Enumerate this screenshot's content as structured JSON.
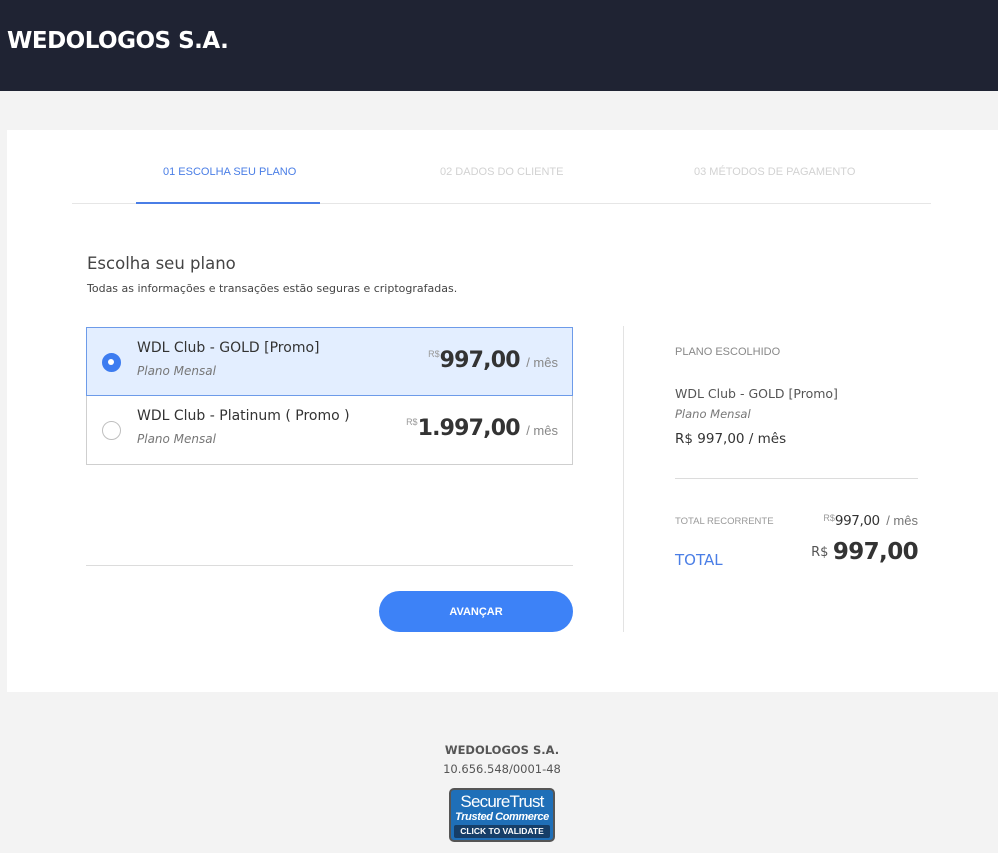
{
  "header": {
    "brand": "WEDOLOGOS S.A."
  },
  "steps": [
    {
      "label": "01 ESCOLHA SEU PLANO",
      "active": true
    },
    {
      "label": "02 DADOS DO CLIENTE",
      "active": false
    },
    {
      "label": "03 MÉTODOS DE PAGAMENTO",
      "active": false
    }
  ],
  "section": {
    "title": "Escolha seu plano",
    "subtitle": "Todas as informações e transações estão seguras e criptografadas."
  },
  "plans": [
    {
      "name": "WDL Club - GOLD [Promo]",
      "period": "Plano Mensal",
      "currency": "R$",
      "amount": "997,00",
      "per": "/ mês",
      "selected": true
    },
    {
      "name": "WDL Club - Platinum ( Promo )",
      "period": "Plano Mensal",
      "currency": "R$",
      "amount": "1.997,00",
      "per": "/ mês",
      "selected": false
    }
  ],
  "actions": {
    "next_label": "AVANÇAR"
  },
  "summary": {
    "heading": "PLANO ESCOLHIDO",
    "plan_name": "WDL Club - GOLD [Promo]",
    "plan_period": "Plano Mensal",
    "plan_price": "R$ 997,00 / mês",
    "recurring_label": "TOTAL RECORRENTE",
    "recurring_currency": "R$",
    "recurring_amount": "997,00",
    "recurring_per": "/ mês",
    "total_label": "TOTAL",
    "total_currency": "R$",
    "total_amount": "997,00"
  },
  "footer": {
    "company": "WEDOLOGOS S.A.",
    "cnpj": "10.656.548/0001-48",
    "seal_line1": "SecureTrust",
    "seal_line2": "Trusted Commerce",
    "seal_line3": "CLICK TO VALIDATE"
  },
  "colors": {
    "header_bg": "#1f2333",
    "accent": "#4a7ee6",
    "button": "#3d82f7",
    "selected_bg": "#e3eeff"
  }
}
